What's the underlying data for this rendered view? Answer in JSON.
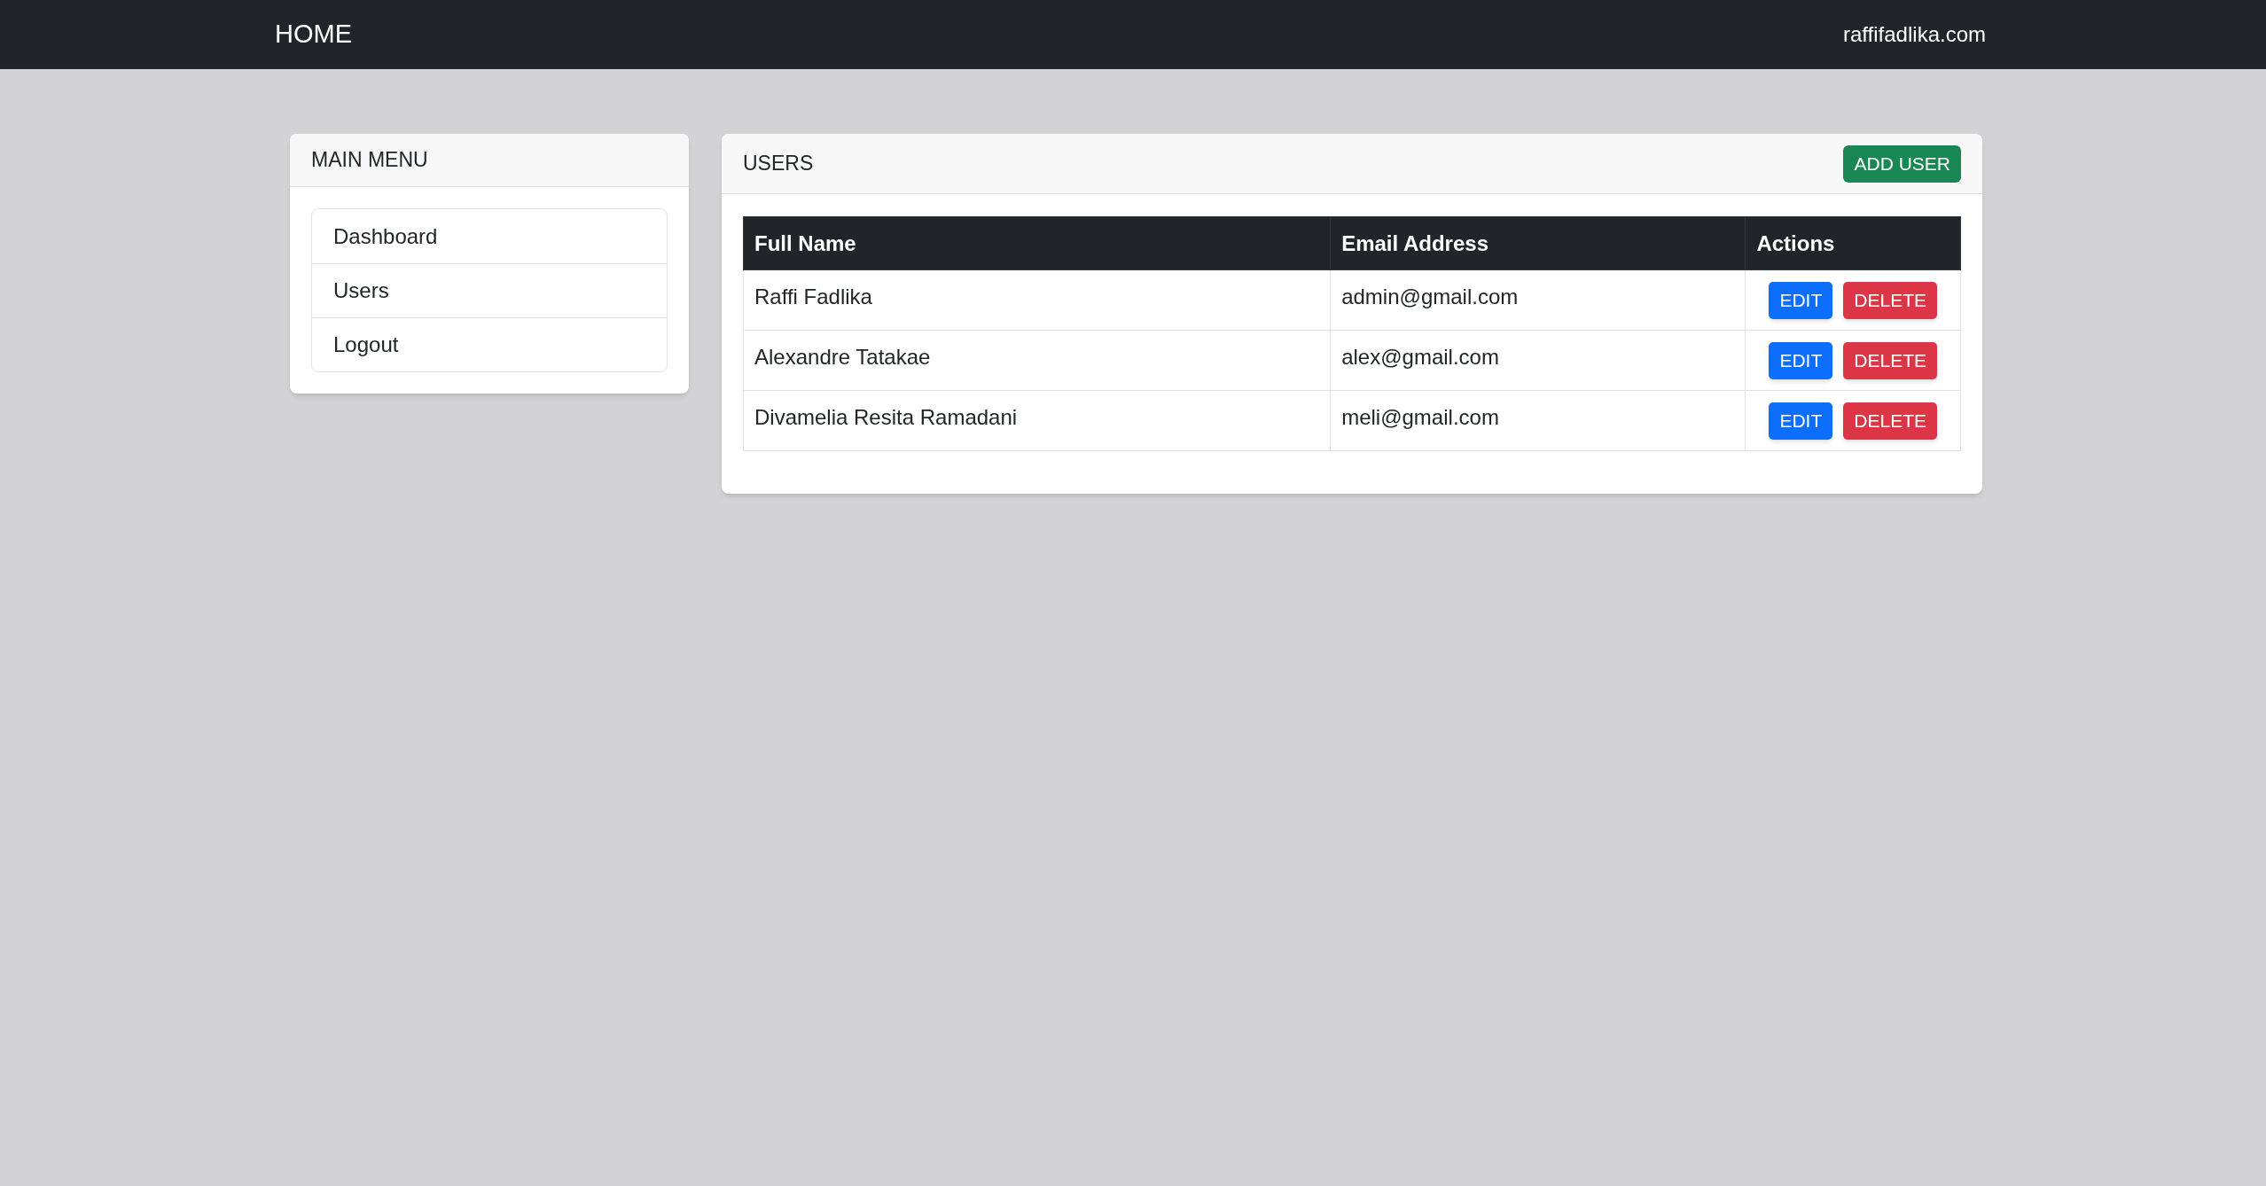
{
  "navbar": {
    "brand": "HOME",
    "site": "raffifadlika.com"
  },
  "menu": {
    "title": "MAIN MENU",
    "items": [
      {
        "label": "Dashboard"
      },
      {
        "label": "Users"
      },
      {
        "label": "Logout"
      }
    ]
  },
  "users": {
    "title": "USERS",
    "add_button": "ADD USER",
    "columns": [
      "Full Name",
      "Email Address",
      "Actions"
    ],
    "rows": [
      {
        "name": "Raffi Fadlika",
        "email": "admin@gmail.com",
        "edit": "EDIT",
        "delete": "DELETE"
      },
      {
        "name": "Alexandre Tatakae",
        "email": "alex@gmail.com",
        "edit": "EDIT",
        "delete": "DELETE"
      },
      {
        "name": "Divamelia Resita Ramadani",
        "email": "meli@gmail.com",
        "edit": "EDIT",
        "delete": "DELETE"
      }
    ]
  }
}
